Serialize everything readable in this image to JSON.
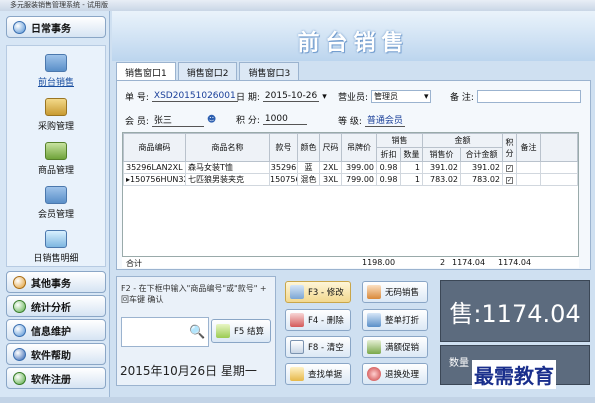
{
  "window": {
    "title": "多元服装销售管理系统 - 试用版"
  },
  "sidebar": {
    "daily": "日常事务",
    "items": [
      {
        "label": "前台销售",
        "icon": "computer-icon"
      },
      {
        "label": "采购管理",
        "icon": "box-icon"
      },
      {
        "label": "商品管理",
        "icon": "goods-icon"
      },
      {
        "label": "会员管理",
        "icon": "member-icon"
      },
      {
        "label": "日销售明细",
        "icon": "list-icon"
      }
    ],
    "sections": [
      {
        "label": "其他事务"
      },
      {
        "label": "统计分析"
      },
      {
        "label": "信息维护"
      },
      {
        "label": "软件帮助"
      },
      {
        "label": "软件注册"
      }
    ]
  },
  "banner": {
    "title": "前台销售"
  },
  "tabs": [
    "销售窗口1",
    "销售窗口2",
    "销售窗口3"
  ],
  "form": {
    "order_label": "单 号:",
    "order_value": "XSD20151026001",
    "date_label": "日 期:",
    "date_value": "2015-10-26",
    "salesperson_label": "营业员:",
    "salesperson_value": "管理员",
    "note_label": "备 注:",
    "member_label": "会 员:",
    "member_value": "张三",
    "points_label": "积 分:",
    "points_value": "1000",
    "level_label": "等 级:",
    "level_value": "普通会员"
  },
  "table": {
    "group_sales": "销售",
    "group_amount": "金额",
    "headers": [
      "商品编码",
      "商品名称",
      "款号",
      "颜色",
      "尺码",
      "吊牌价",
      "折扣",
      "数量",
      "销售价",
      "合计金额",
      "积分",
      "备注"
    ],
    "rows": [
      [
        "35296LAN2XL",
        "森马女装T恤",
        "35296",
        "蓝",
        "2XL",
        "399.00",
        "0.98",
        "1",
        "391.02",
        "391.02"
      ],
      [
        "150756HUN3XL",
        "七匹狼男装夹克",
        "150756",
        "混色",
        "3XL",
        "799.00",
        "0.98",
        "1",
        "783.02",
        "783.02"
      ]
    ],
    "total_label": "合计",
    "total_tag_price": "1198.00",
    "total_qty": "2",
    "total_sale": "1174.04",
    "total_amount": "1174.04"
  },
  "hint": {
    "text": "F2 - 在下框中输入\"商品编号\"或\"款号\" + 回车键 确认",
    "checkout": "F5 结算",
    "date": "2015年10月26日 星期一"
  },
  "buttons": {
    "modify": "F3 - 修改",
    "delete": "F4 - 删除",
    "clear": "F8 - 清空",
    "lookup": "查找单据",
    "nobarcode": "无码销售",
    "discount": "整单打折",
    "promo": "满额促销",
    "return": "退换处理"
  },
  "display": {
    "total": "售:1174.04",
    "qty_label": "数量"
  },
  "watermark": "最需教育"
}
